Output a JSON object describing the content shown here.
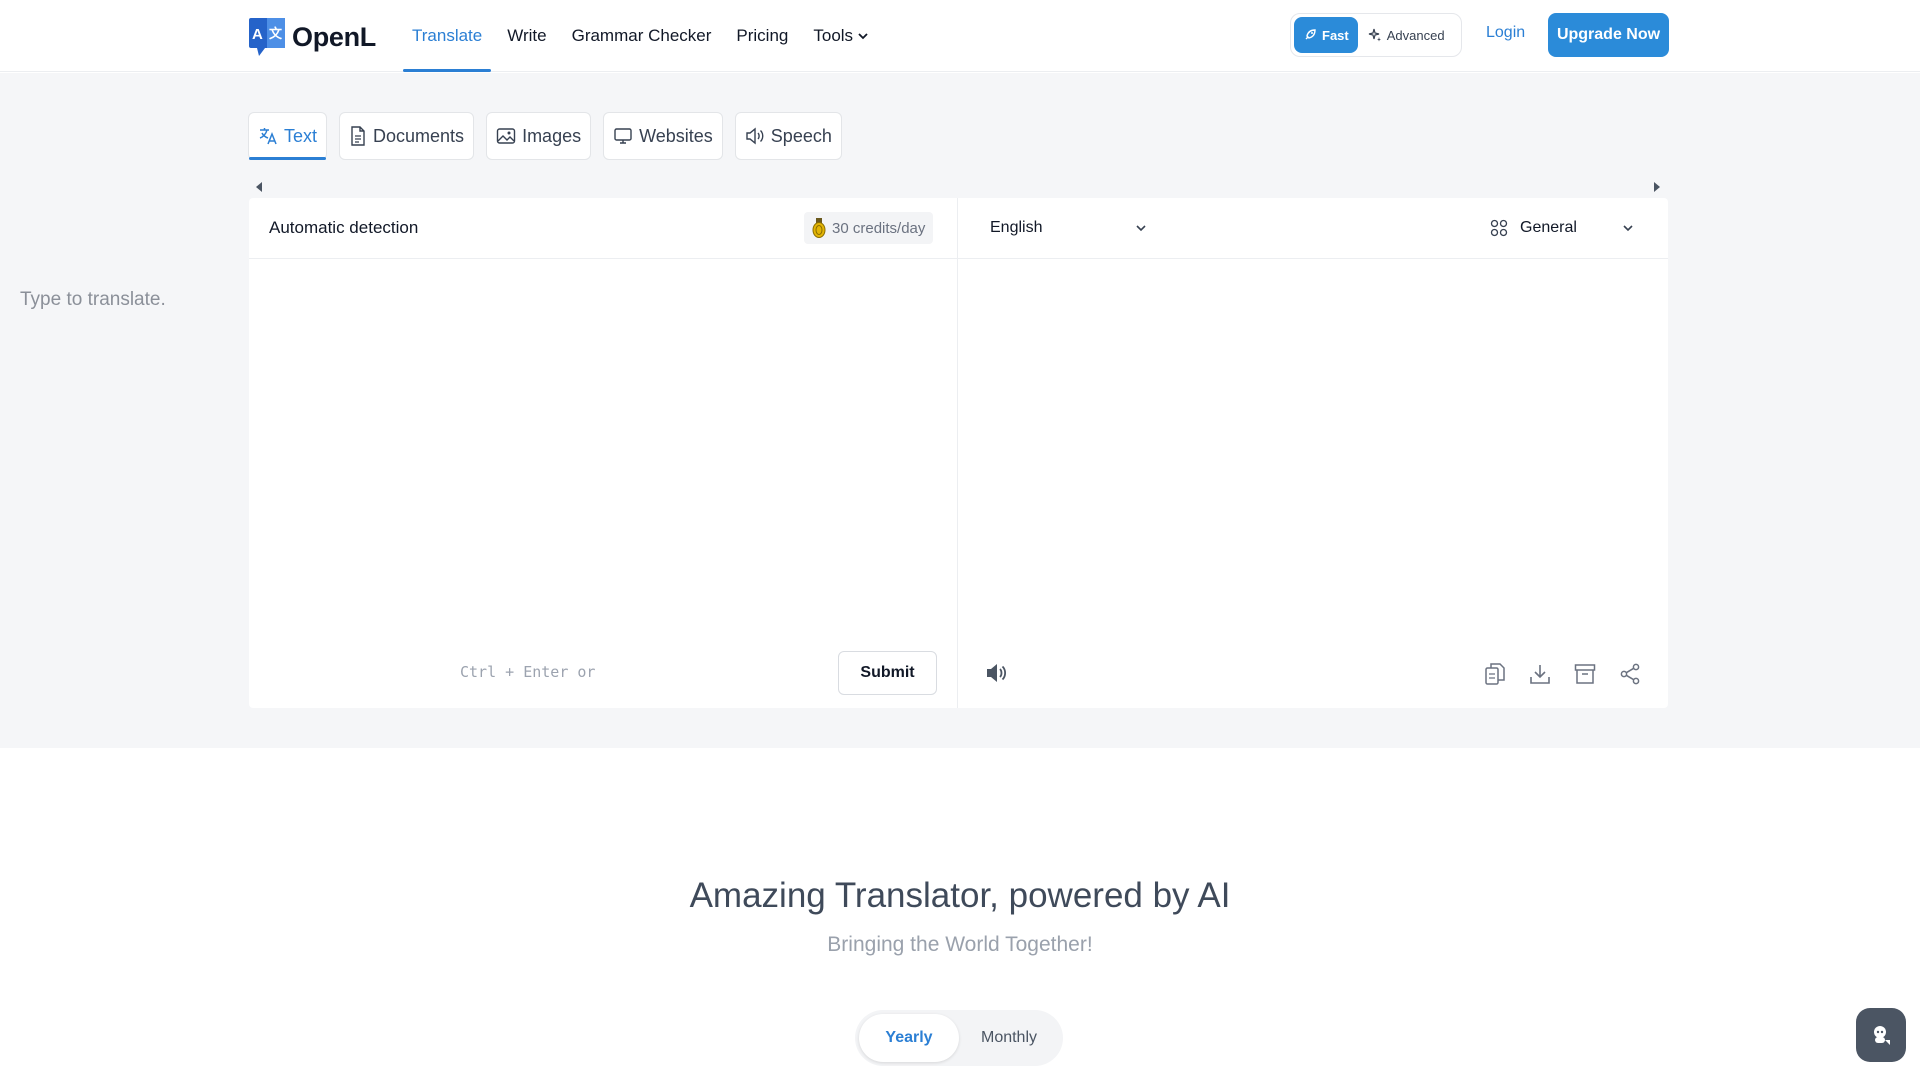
{
  "header": {
    "logo_text": "OpenL",
    "nav": [
      {
        "label": "Translate",
        "active": true
      },
      {
        "label": "Write"
      },
      {
        "label": "Grammar Checker"
      },
      {
        "label": "Pricing"
      },
      {
        "label": "Tools",
        "has_dropdown": true
      }
    ],
    "modes": {
      "fast_label": "Fast",
      "advanced_label": "Advanced",
      "selected": "Fast"
    },
    "login_label": "Login",
    "upgrade_label": "Upgrade Now"
  },
  "tabs": [
    {
      "label": "Text",
      "icon": "translate-icon",
      "active": true
    },
    {
      "label": "Documents",
      "icon": "document-icon"
    },
    {
      "label": "Images",
      "icon": "image-icon"
    },
    {
      "label": "Websites",
      "icon": "monitor-icon"
    },
    {
      "label": "Speech",
      "icon": "speaker-icon"
    }
  ],
  "translator": {
    "source_language": "Automatic detection",
    "credits": "30 credits/day",
    "input_value": "",
    "input_placeholder": "Type to translate.",
    "shortcut_hint": "Ctrl + Enter or",
    "submit_label": "Submit",
    "target_language": "English",
    "domain": "General",
    "output_actions": [
      "copy-icon",
      "download-icon",
      "archive-icon",
      "share-icon"
    ]
  },
  "hero": {
    "title": "Amazing Translator, powered by AI",
    "subtitle": "Bringing the World Together!"
  },
  "billing": {
    "options": [
      "Yearly",
      "Monthly"
    ],
    "selected": "Yearly"
  },
  "colors": {
    "accent": "#2b8bd9",
    "link": "#2b7fd4",
    "band_bg": "#f5f6f8"
  }
}
